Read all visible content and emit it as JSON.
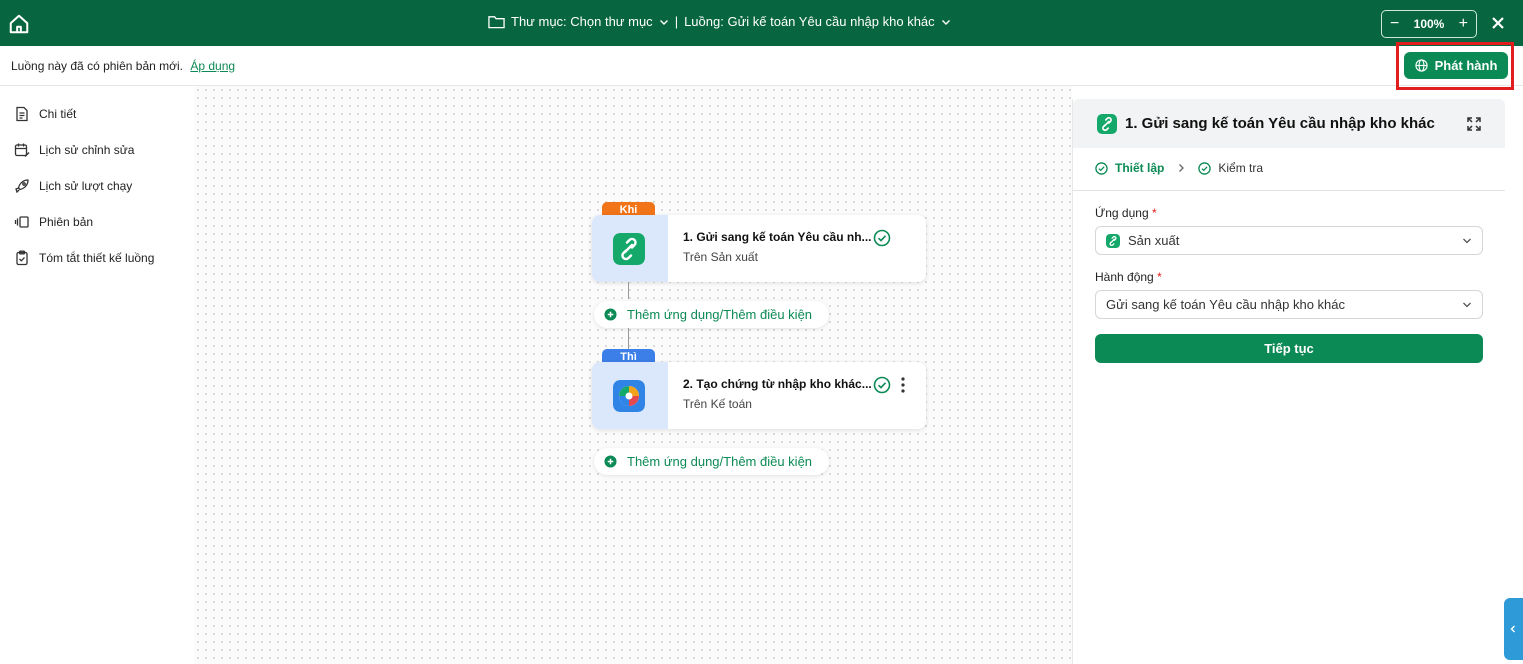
{
  "header": {
    "folder_label": "Thư mục: Chọn thư mục",
    "separator": "|",
    "flow_label": "Luồng: Gửi kế toán Yêu cầu nhập kho khác",
    "zoom": "100%",
    "zoom_minus": "−",
    "zoom_plus": "+"
  },
  "notice": {
    "text": "Luồng này đã có phiên bản mới.",
    "link": "Áp dụng",
    "publish_label": "Phát hành"
  },
  "sidebar": {
    "items": [
      {
        "label": "Chi tiết",
        "icon": "document-icon"
      },
      {
        "label": "Lịch sử chỉnh sửa",
        "icon": "calendar-edit-icon"
      },
      {
        "label": "Lịch sử lượt chạy",
        "icon": "rocket-icon"
      },
      {
        "label": "Phiên bản",
        "icon": "versions-icon"
      },
      {
        "label": "Tóm tắt thiết kế luồng",
        "icon": "clipboard-icon"
      }
    ]
  },
  "flow": {
    "trigger_tag": "Khi",
    "action_tag": "Thì",
    "nodes": [
      {
        "title": "1. Gửi sang kế toán Yêu cầu nh...",
        "subtitle": "Trên Sản xuất",
        "status": "complete"
      },
      {
        "title": "2. Tạo chứng từ nhập kho khác...",
        "subtitle": "Trên Kế toán",
        "status": "complete"
      }
    ],
    "add_label": "Thêm ứng dụng/Thêm điều kiện"
  },
  "panel": {
    "title": "1. Gửi sang kế toán Yêu cầu nhập kho khác",
    "steps": [
      {
        "label": "Thiết lập",
        "active": true
      },
      {
        "label": "Kiểm tra",
        "active": false
      }
    ],
    "app_label": "Ứng dụng",
    "app_value": "Sản xuất",
    "action_label": "Hành động",
    "action_value": "Gửi sang kế toán Yêu cầu nhập kho khác",
    "required_mark": "*",
    "continue_label": "Tiếp tục"
  },
  "colors": {
    "header_bg": "#07663f",
    "accent": "#0c8a55",
    "trigger_tag": "#f27418",
    "action_tag": "#3c7fe8",
    "highlight_border": "#e11d1d"
  }
}
